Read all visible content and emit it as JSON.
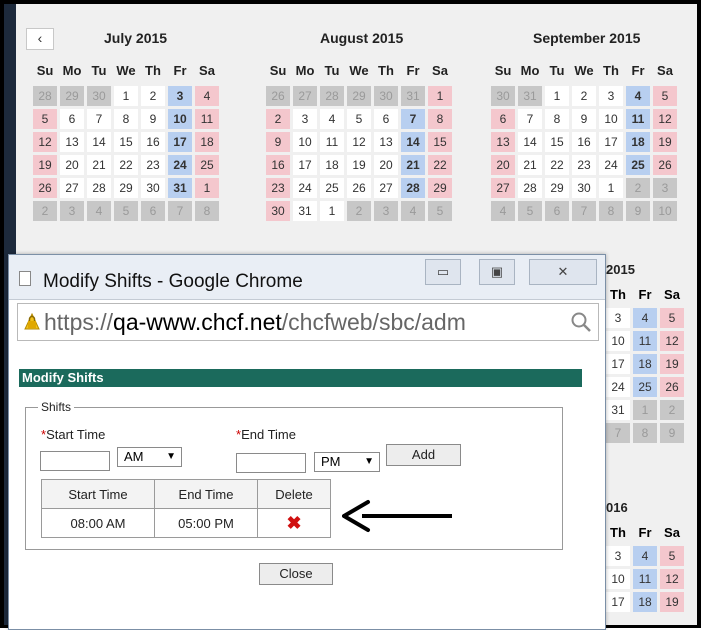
{
  "calendar": {
    "prev_label": "‹",
    "dow": [
      "Su",
      "Mo",
      "Tu",
      "We",
      "Th",
      "Fr",
      "Sa"
    ],
    "months": [
      {
        "title": "July 2015",
        "days": [
          "28",
          "29",
          "30",
          "1",
          "2",
          "3",
          "4",
          "5",
          "6",
          "7",
          "8",
          "9",
          "10",
          "11",
          "12",
          "13",
          "14",
          "15",
          "16",
          "17",
          "18",
          "19",
          "20",
          "21",
          "22",
          "23",
          "24",
          "25",
          "26",
          "27",
          "28",
          "29",
          "30",
          "31",
          "1",
          "2",
          "3",
          "4",
          "5",
          "6",
          "7",
          "8"
        ]
      },
      {
        "title": "August 2015",
        "days": [
          "26",
          "27",
          "28",
          "29",
          "30",
          "31",
          "1",
          "2",
          "3",
          "4",
          "5",
          "6",
          "7",
          "8",
          "9",
          "10",
          "11",
          "12",
          "13",
          "14",
          "15",
          "16",
          "17",
          "18",
          "19",
          "20",
          "21",
          "22",
          "23",
          "24",
          "25",
          "26",
          "27",
          "28",
          "29",
          "30",
          "31",
          "1",
          "2",
          "3",
          "4",
          "5"
        ]
      },
      {
        "title": "September 2015",
        "days": [
          "30",
          "31",
          "1",
          "2",
          "3",
          "4",
          "5",
          "6",
          "7",
          "8",
          "9",
          "10",
          "11",
          "12",
          "13",
          "14",
          "15",
          "16",
          "17",
          "18",
          "19",
          "20",
          "21",
          "22",
          "23",
          "24",
          "25",
          "26",
          "27",
          "28",
          "29",
          "30",
          "1",
          "2",
          "3",
          "4",
          "5",
          "6",
          "7",
          "8",
          "9",
          "10"
        ]
      }
    ],
    "side_top": {
      "header": "2015",
      "dow": [
        "Th",
        "Fr",
        "Sa"
      ],
      "days": [
        "3",
        "4",
        "5",
        "10",
        "11",
        "12",
        "17",
        "18",
        "19",
        "24",
        "25",
        "26",
        "31",
        "1",
        "2",
        "7",
        "8",
        "9"
      ]
    },
    "side_bottom": {
      "header": "016",
      "dow": [
        "Th",
        "Fr",
        "Sa"
      ],
      "days": [
        "3",
        "4",
        "5",
        "10",
        "11",
        "12",
        "17",
        "18",
        "19"
      ]
    }
  },
  "window": {
    "title": "Modify Shifts - Google Chrome",
    "url_scheme": "https://",
    "url_host": "qa-www.chcf.net",
    "url_path": "/chcfweb/sbc/adm",
    "minimize": "▭",
    "maximize": "▣",
    "close": "✕"
  },
  "form": {
    "header": "Modify Shifts",
    "legend": "Shifts",
    "required_mark": "*",
    "start_label": "Start Time",
    "end_label": "End Time",
    "start_value": "",
    "end_value": "",
    "start_ampm": "AM",
    "end_ampm": "PM",
    "add_label": "Add",
    "close_label": "Close",
    "table": {
      "headers": [
        "Start Time",
        "End Time",
        "Delete"
      ],
      "rows": [
        {
          "start": "08:00 AM",
          "end": "05:00 PM",
          "delete": "✖"
        }
      ]
    }
  },
  "colors": {
    "header_green": "#1b6a5c",
    "weekend_pink": "#f4c7cd",
    "friday_blue": "#b8cff0"
  }
}
